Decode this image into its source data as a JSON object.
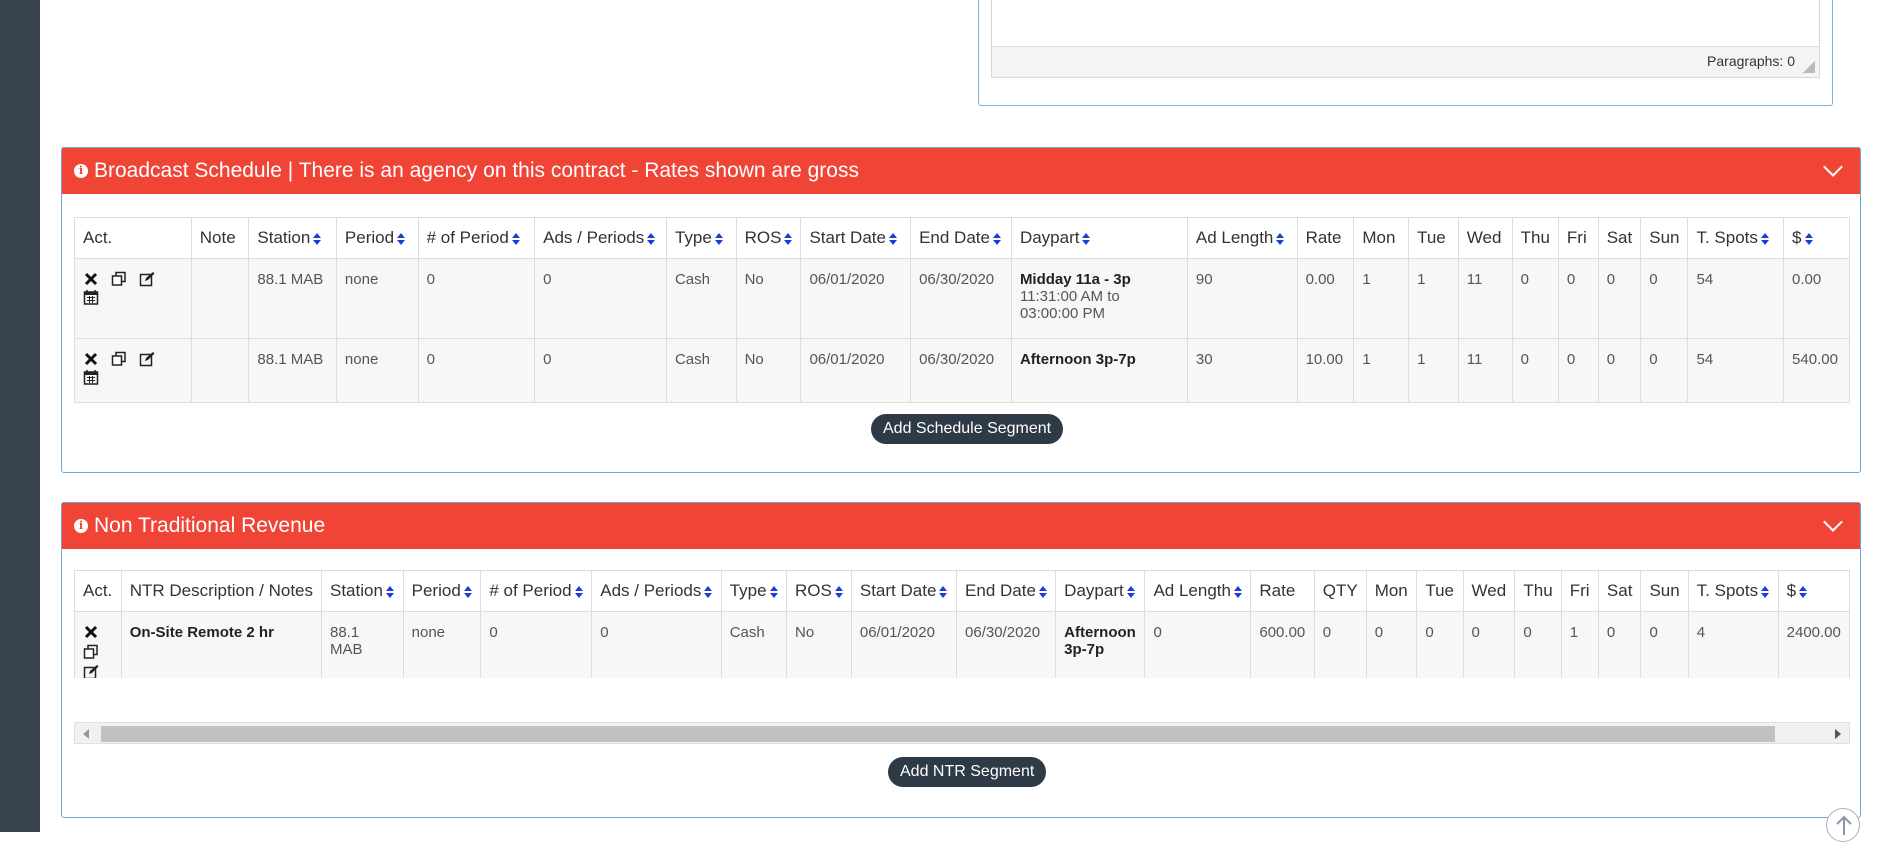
{
  "editor": {
    "status": "Paragraphs: 0"
  },
  "broadcast": {
    "title": "Broadcast Schedule | There is an agency on this contract - Rates shown are gross",
    "headers": [
      "Act.",
      "Note",
      "Station",
      "Period",
      "# of Period",
      "Ads / Periods",
      "Type",
      "ROS",
      "Start Date",
      "End Date",
      "Daypart",
      "Ad Length",
      "Rate",
      "Mon",
      "Tue",
      "Wed",
      "Thu",
      "Fri",
      "Sat",
      "Sun",
      "T. Spots",
      "$"
    ],
    "rows": [
      {
        "note": "",
        "station": "88.1 MAB",
        "period": "none",
        "num_period": "0",
        "ads_periods": "0",
        "type": "Cash",
        "ros": "No",
        "start": "06/01/2020",
        "end": "06/30/2020",
        "daypart": "Midday 11a - 3p",
        "daypart_time": "11:31:00 AM to 03:00:00 PM",
        "ad_length": "90",
        "rate": "0.00",
        "mon": "1",
        "tue": "1",
        "wed": "11",
        "thu": "0",
        "fri": "0",
        "sat": "0",
        "sun": "0",
        "t_spots": "54",
        "amount": "0.00"
      },
      {
        "note": "",
        "station": "88.1 MAB",
        "period": "none",
        "num_period": "0",
        "ads_periods": "0",
        "type": "Cash",
        "ros": "No",
        "start": "06/01/2020",
        "end": "06/30/2020",
        "daypart": "Afternoon 3p-7p",
        "daypart_time": "",
        "ad_length": "30",
        "rate": "10.00",
        "mon": "1",
        "tue": "1",
        "wed": "11",
        "thu": "0",
        "fri": "0",
        "sat": "0",
        "sun": "0",
        "t_spots": "54",
        "amount": "540.00"
      }
    ],
    "add_button": "Add Schedule Segment"
  },
  "ntr": {
    "title": "Non Traditional Revenue",
    "headers": [
      "Act.",
      "NTR Description / Notes",
      "Station",
      "Period",
      "# of Period",
      "Ads / Periods",
      "Type",
      "ROS",
      "Start Date",
      "End Date",
      "Daypart",
      "Ad Length",
      "Rate",
      "QTY",
      "Mon",
      "Tue",
      "Wed",
      "Thu",
      "Fri",
      "Sat",
      "Sun",
      "T. Spots",
      "$"
    ],
    "rows": [
      {
        "description": "On-Site Remote 2 hr",
        "station": "88.1 MAB",
        "period": "none",
        "num_period": "0",
        "ads_periods": "0",
        "type": "Cash",
        "ros": "No",
        "start": "06/01/2020",
        "end": "06/30/2020",
        "daypart": "Afternoon 3p-7p",
        "ad_length": "0",
        "rate": "600.00",
        "qty": "0",
        "mon": "0",
        "tue": "0",
        "wed": "0",
        "thu": "0",
        "fri": "1",
        "sat": "0",
        "sun": "0",
        "t_spots": "4",
        "amount": "2400.00"
      }
    ],
    "add_button": "Add NTR Segment"
  },
  "icons": {
    "delete": "times-icon",
    "copy": "copy-icon",
    "edit": "edit-icon",
    "calendar": "calendar-icon",
    "info": "info-circle-icon",
    "collapse": "chevron-down-icon",
    "scroll_top": "arrow-up-circle-icon"
  },
  "colors": {
    "header_red": "#f04437",
    "sidebar": "#38434f",
    "button_dark": "#2f3a47",
    "sort_blue": "#1a3fd6"
  }
}
